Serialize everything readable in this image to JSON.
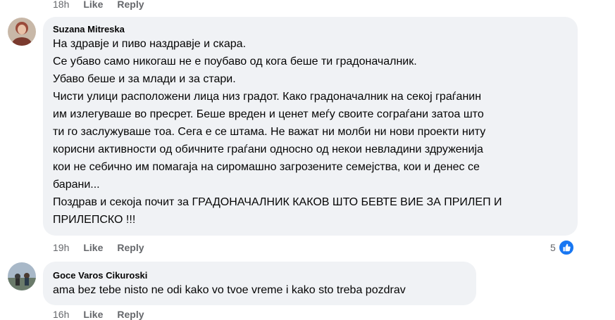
{
  "top_actions": {
    "time": "18h",
    "like": "Like",
    "reply": "Reply"
  },
  "comments": [
    {
      "author": "Suzana Mitreska",
      "lines": [
        "На здравје и пиво наздравје и скара.",
        "Се убаво само никогаш не е поубаво од кога беше ти градоначалник.",
        "Убаво беше и за млади и за стари.",
        "Чисти улици расположени лица низ градот. Како градоначалник на секој граѓанин",
        "им излегуваше во пресрет. Беше вреден и ценет меѓу своите сограѓани затоа што",
        "ти го заслужуваше тоа. Сега е се штама. Не важат ни молби ни нови проекти ниту",
        "корисни активности од обичните граѓани односно од некои невладини здруженија",
        "кои не себично им помагаја на сиромашно загрозените семејства, кои и денес се",
        "барани...",
        "Поздрав и секоја почит за ГРАДОНАЧАЛНИК КАКОВ ШТО БЕВТЕ ВИЕ ЗА ПРИЛЕП И",
        "ПРИЛЕПСКО !!!"
      ],
      "time": "19h",
      "like": "Like",
      "reply": "Reply",
      "reaction_count": "5",
      "reaction_icon": "like-icon"
    },
    {
      "author": "Goce Varos Cikuroski",
      "lines": [
        "ama bez tebe nisto ne odi kako vo tvoe vreme i kako sto treba pozdrav"
      ],
      "time": "16h",
      "like": "Like",
      "reply": "Reply"
    }
  ],
  "colors": {
    "bubble": "#f0f2f5",
    "meta": "#65676b",
    "like_blue": "#1877f2"
  }
}
